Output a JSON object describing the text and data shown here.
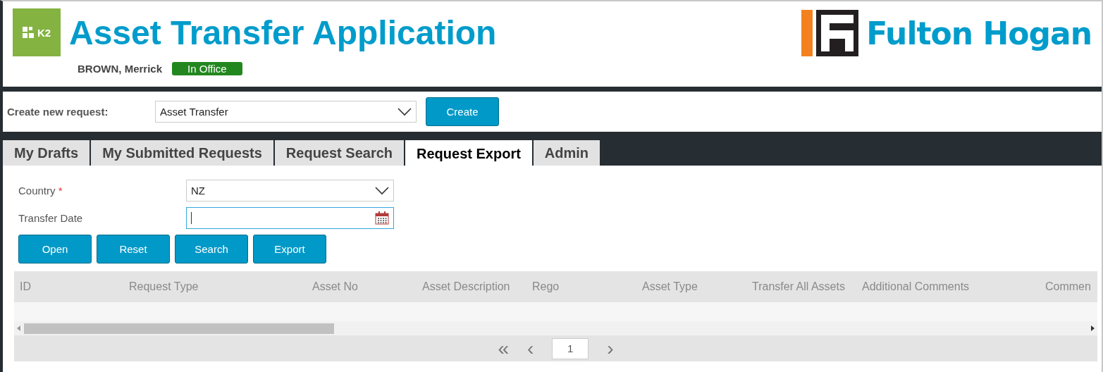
{
  "header": {
    "logo_text": "K2",
    "title": "Asset Transfer Application",
    "brand": "Fulton Hogan",
    "user": "BROWN, Merrick",
    "status": "In Office"
  },
  "create_bar": {
    "label": "Create new request:",
    "value": "Asset Transfer",
    "button": "Create"
  },
  "tabs": [
    {
      "label": "My Drafts",
      "selected": false
    },
    {
      "label": "My Submitted Requests",
      "selected": false
    },
    {
      "label": "Request Search",
      "selected": false
    },
    {
      "label": "Request Export",
      "selected": true
    },
    {
      "label": "Admin",
      "selected": false
    }
  ],
  "form": {
    "fields": [
      {
        "kind": "select",
        "label": "Country",
        "required": true,
        "value": "NZ"
      },
      {
        "kind": "date",
        "label": "Transfer Date",
        "required": false,
        "focused": true
      }
    ],
    "required_mark": "*",
    "buttons": [
      "Open",
      "Reset",
      "Search",
      "Export"
    ]
  },
  "table": {
    "columns": [
      "ID",
      "Request Type",
      "Asset No",
      "Asset Description",
      "Rego",
      "Asset Type",
      "Transfer All Assets",
      "Additional Comments",
      "Commen"
    ],
    "pager": {
      "first": "«",
      "prev": "‹",
      "page": "1",
      "next": "›"
    }
  }
}
